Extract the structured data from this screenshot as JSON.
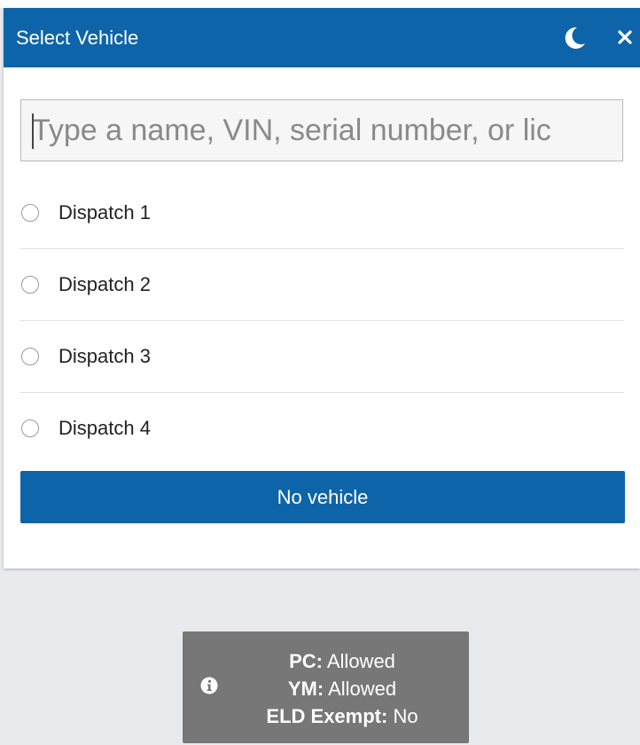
{
  "dialog": {
    "title": "Select Vehicle",
    "icons": {
      "theme": "moon-icon",
      "close": "close-icon"
    }
  },
  "search": {
    "placeholder": "Type a name, VIN, serial number, or lic",
    "value": ""
  },
  "vehicles": [
    {
      "label": "Dispatch 1",
      "selected": false
    },
    {
      "label": "Dispatch 2",
      "selected": false
    },
    {
      "label": "Dispatch 3",
      "selected": false
    },
    {
      "label": "Dispatch 4",
      "selected": false
    }
  ],
  "no_vehicle_button": "No vehicle",
  "status": {
    "icon": "info-icon",
    "pc_key": "PC:",
    "pc_value": "Allowed",
    "ym_key": "YM:",
    "ym_value": "Allowed",
    "eld_key": "ELD Exempt:",
    "eld_value": "No"
  },
  "colors": {
    "header": "#0e64a8",
    "button": "#0e64a8",
    "toast": "#777777",
    "backdrop": "#e9eaee"
  }
}
